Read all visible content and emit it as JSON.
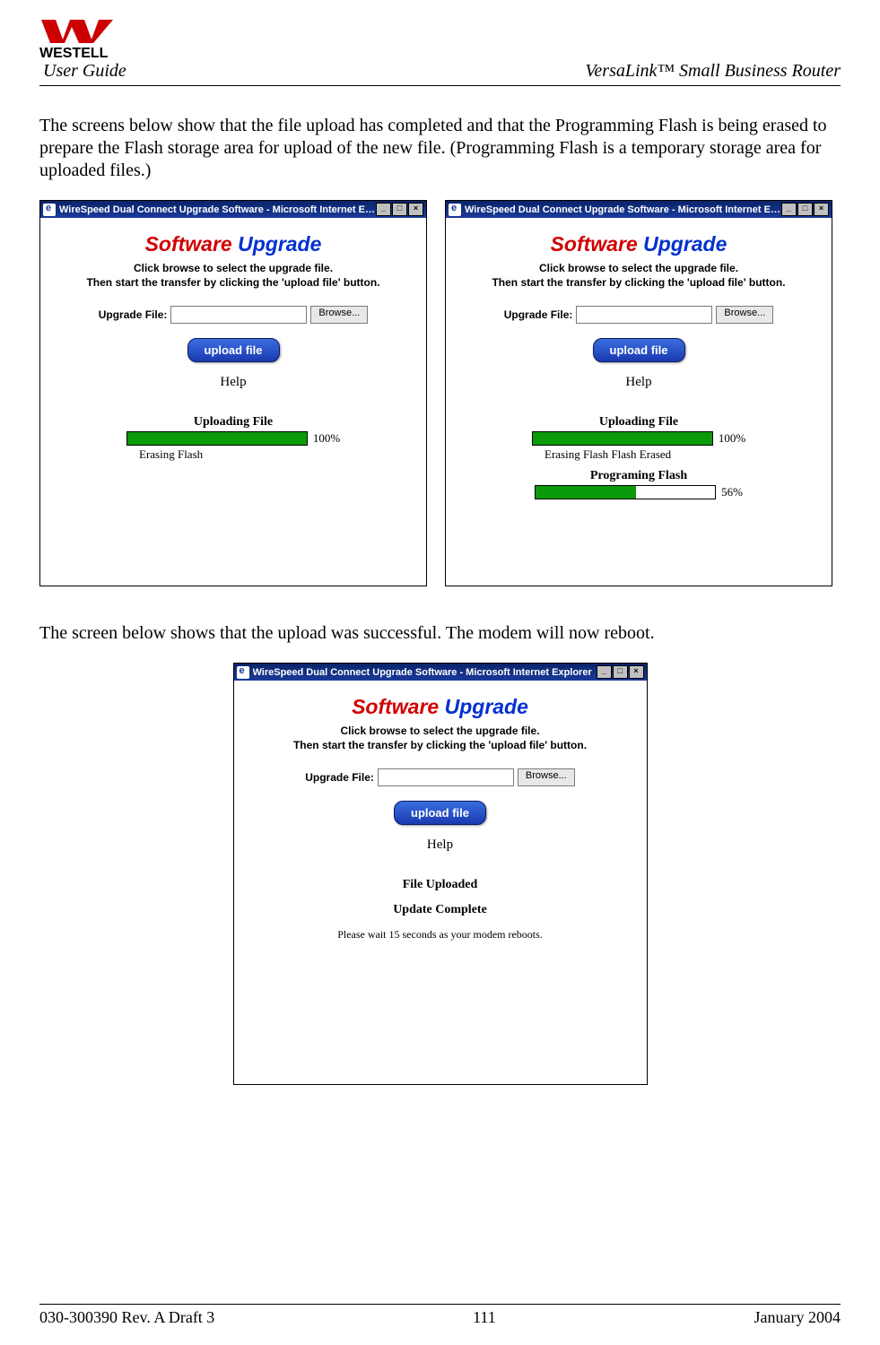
{
  "header": {
    "brand": "WESTELL",
    "user_guide": "User Guide",
    "product": "VersaLink™  Small Business Router"
  },
  "paragraphs": {
    "p1": "The screens below show that the file upload has completed and that the Programming Flash is being erased to prepare the Flash storage area for upload of the new file. (Programming Flash is a temporary storage area for uploaded files.)",
    "p2": "The screen below shows that the upload was successful. The modem will now reboot."
  },
  "window": {
    "title": "WireSpeed Dual Connect Upgrade Software - Microsoft Internet Explorer",
    "min": "_",
    "max": "□",
    "close": "×",
    "sw_title_1": "Software ",
    "sw_title_2": "Upgrade",
    "instr1": "Click browse to select the upgrade file.",
    "instr2": "Then start the transfer by clicking the 'upload file' button.",
    "file_label": "Upgrade File:",
    "browse": "Browse...",
    "upload": "upload file",
    "help": "Help"
  },
  "screen_left": {
    "uploading_label": "Uploading File",
    "pct": "100%",
    "fill": 100,
    "status": "Erasing Flash"
  },
  "screen_right": {
    "uploading_label": "Uploading File",
    "pct1": "100%",
    "fill1": 100,
    "status1": "Erasing Flash   Flash Erased",
    "prog_label": "Programing Flash",
    "pct2": "56%",
    "fill2": 56
  },
  "screen_bottom": {
    "file_uploaded": "File Uploaded",
    "update_complete": "Update Complete",
    "wait": "Please wait 15 seconds as your modem reboots."
  },
  "footer": {
    "left": "030-300390 Rev. A Draft 3",
    "center": "111",
    "right": "January 2004"
  }
}
